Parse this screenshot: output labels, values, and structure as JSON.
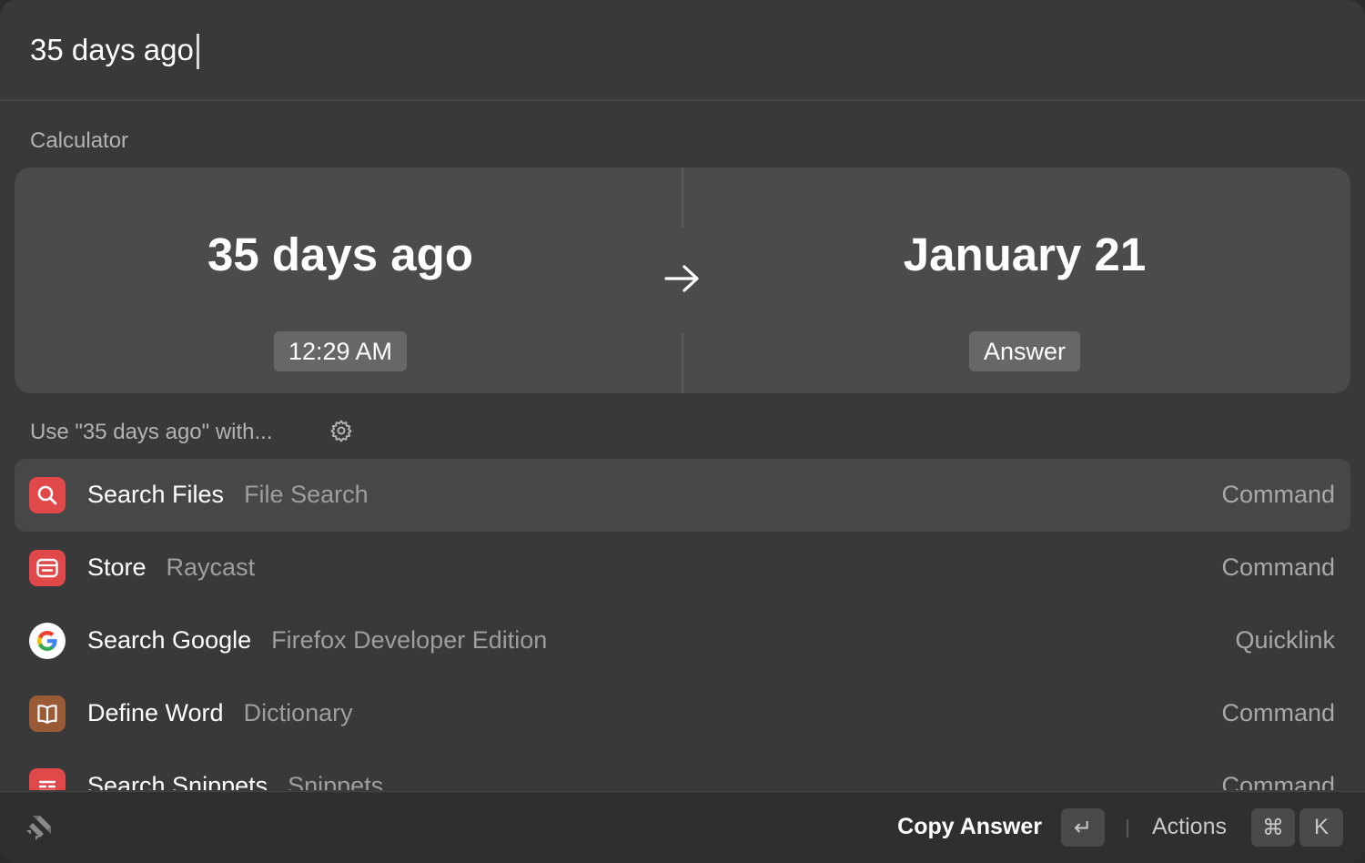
{
  "search": {
    "value": "35 days ago"
  },
  "calculator": {
    "section_title": "Calculator",
    "input_expression": "35 days ago",
    "input_detail": "12:29 AM",
    "result_value": "January 21",
    "result_label": "Answer"
  },
  "fallback": {
    "section_title": "Use \"35 days ago\" with..."
  },
  "results": [
    {
      "title": "Search Files",
      "subtitle": "File Search",
      "type": "Command",
      "icon": "magnifier-icon",
      "icon_color": "#e0484a",
      "selected": true
    },
    {
      "title": "Store",
      "subtitle": "Raycast",
      "type": "Command",
      "icon": "store-icon",
      "icon_color": "#e0484a",
      "selected": false
    },
    {
      "title": "Search Google",
      "subtitle": "Firefox Developer Edition",
      "type": "Quicklink",
      "icon": "google-icon",
      "icon_color": "#ffffff",
      "selected": false
    },
    {
      "title": "Define Word",
      "subtitle": "Dictionary",
      "type": "Command",
      "icon": "book-icon",
      "icon_color": "#9a5a35",
      "selected": false
    },
    {
      "title": "Search Snippets",
      "subtitle": "Snippets",
      "type": "Command",
      "icon": "snippets-icon",
      "icon_color": "#e0484a",
      "selected": false
    }
  ],
  "footer": {
    "primary_action": "Copy Answer",
    "enter_key": "↵",
    "actions_label": "Actions",
    "cmd_key": "⌘",
    "k_key": "K"
  },
  "colors": {
    "window_bg": "#393939",
    "card_bg": "#4b4b4b",
    "selected_row_bg": "#474747",
    "accent_red": "#e0484a"
  }
}
